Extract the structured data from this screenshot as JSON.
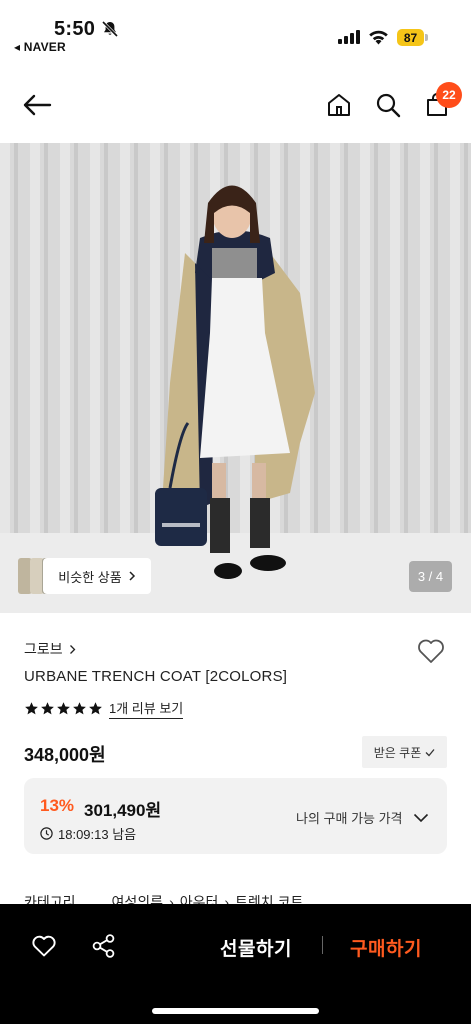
{
  "status_bar": {
    "time": "5:50",
    "back_app": "◂ NAVER",
    "battery": "87",
    "bell_icon": "bell-slash-icon",
    "signal_icon": "cellular-signal-icon",
    "wifi_icon": "wifi-icon"
  },
  "header": {
    "back_icon": "arrow-left-icon",
    "home_icon": "home-icon",
    "search_icon": "search-icon",
    "cart_icon": "shopping-bag-icon",
    "cart_count": "22"
  },
  "gallery": {
    "similar_label": "비슷한 상품",
    "counter": "3 / 4"
  },
  "product": {
    "brand": "그로브",
    "name": "URBANE TRENCH COAT [2COLORS]",
    "rating": 5,
    "review_link": "1개 리뷰 보기",
    "price": "348,000원",
    "coupon_label": "받은 쿠폰"
  },
  "discount": {
    "percent": "13%",
    "price": "301,490원",
    "remaining": "18:09:13 남음",
    "my_price_label": "나의 구매 가능 가격"
  },
  "category": {
    "label": "카테고리",
    "path": [
      "여성의류",
      "아우터",
      "트렌치 코트"
    ]
  },
  "bottom_bar": {
    "wishlist_icon": "heart-outline-icon",
    "share_icon": "share-icon",
    "gift_label": "선물하기",
    "buy_label": "구매하기"
  },
  "colors": {
    "accent": "#ff5a1f",
    "badge": "#ff4d1a",
    "battery": "#f5c518",
    "bottom_bar_bg": "#000000"
  }
}
